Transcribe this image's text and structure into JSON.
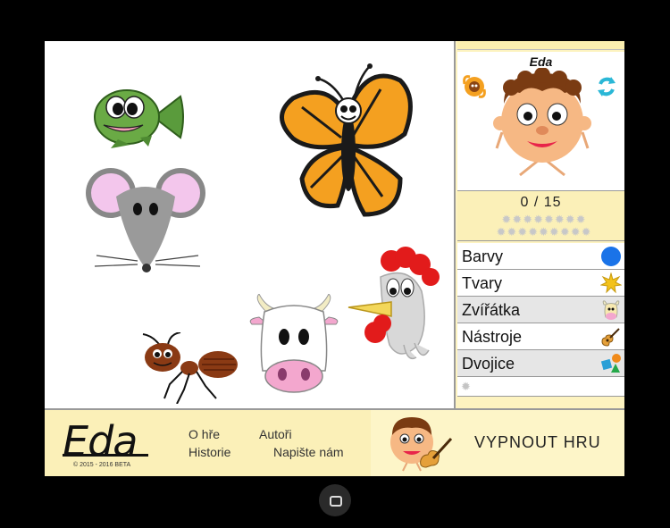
{
  "app": {
    "avatar_name": "Eda"
  },
  "score": {
    "text": "0 / 15",
    "stars": "✹✹✹✹✹✹✹✹ ✹✹✹✹✹✹✹✹✹"
  },
  "menu": {
    "items": [
      {
        "label": "Barvy",
        "icon": "blue-circle-icon"
      },
      {
        "label": "Tvary",
        "icon": "sun-shape-icon"
      },
      {
        "label": "Zvířátka",
        "icon": "cow-icon"
      },
      {
        "label": "Nástroje",
        "icon": "guitar-icon"
      },
      {
        "label": "Dvojice",
        "icon": "shapes-pair-icon"
      }
    ],
    "empty_star": "✹"
  },
  "animals": [
    "fish",
    "butterfly",
    "mouse",
    "rooster",
    "cow",
    "ant"
  ],
  "footer": {
    "logo": "Eda",
    "copyright": "© 2015 - 2016 BETA",
    "links": {
      "about": "O hře",
      "authors": "Autoři",
      "history": "Historie",
      "contact": "Napište nám"
    },
    "exit_label": "VYPNOUT HRU"
  },
  "colors": {
    "screen_bg": "#ffffff",
    "panel_yellow": "#fbf0b8",
    "menu_alt": "#e6e6e6",
    "accent_blue": "#1a73e8"
  }
}
